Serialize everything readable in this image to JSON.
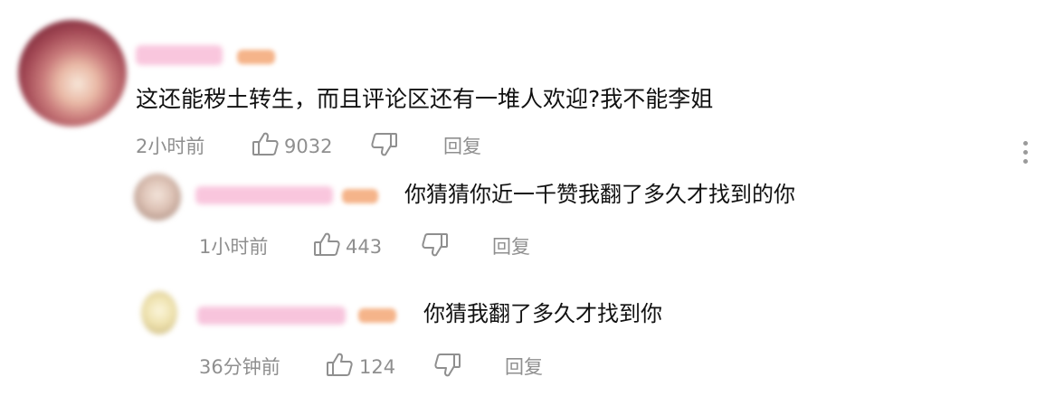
{
  "comments": [
    {
      "text": "这还能秽土转生，而且评论区还有一堆人欢迎?我不能李姐",
      "time": "2小时前",
      "likes": "9032",
      "reply_label": "回复"
    },
    {
      "text": "你猜猜你近一千赞我翻了多久才找到的你",
      "time": "1小时前",
      "likes": "443",
      "reply_label": "回复"
    },
    {
      "text": "你猜我翻了多久才找到你",
      "time": "36分钟前",
      "likes": "124",
      "reply_label": "回复"
    }
  ],
  "icons": {
    "like": "thumbs-up-icon",
    "dislike": "thumbs-down-icon",
    "more": "more-vertical-icon"
  },
  "colors": {
    "meta_text": "#8f8f8f",
    "badge": "#f5b48a",
    "username_blur": "#f7bfd8"
  }
}
